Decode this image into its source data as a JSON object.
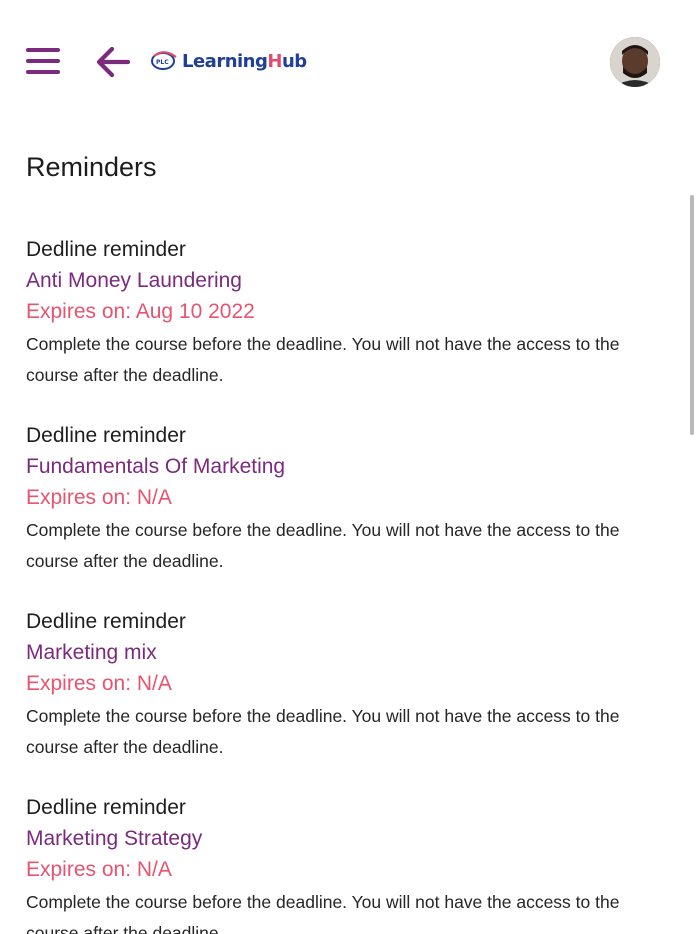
{
  "header": {
    "menu_icon": "hamburger-menu-icon",
    "back_icon": "arrow-left-icon",
    "logo": {
      "mark_text": "PLC",
      "name_prefix": "Learning",
      "name_h": "H",
      "name_suffix": "ub"
    },
    "avatar_icon": "user-avatar"
  },
  "main": {
    "title": "Reminders",
    "reminders": [
      {
        "type": "Dedline reminder",
        "course": "Anti Money Laundering",
        "expiry": "Expires on: Aug 10 2022",
        "description": "Complete the course before the deadline. You will not have the access to the course after the deadline."
      },
      {
        "type": "Dedline reminder",
        "course": "Fundamentals Of Marketing",
        "expiry": "Expires on: N/A",
        "description": "Complete the course before the deadline. You will not have the access to the course after the deadline."
      },
      {
        "type": "Dedline reminder",
        "course": "Marketing mix",
        "expiry": "Expires on: N/A",
        "description": "Complete the course before the deadline. You will not have the access to the course after the deadline."
      },
      {
        "type": "Dedline reminder",
        "course": "Marketing Strategy",
        "expiry": "Expires on: N/A",
        "description": "Complete the course before the deadline. You will not have the access to the course after the deadline."
      }
    ]
  },
  "colors": {
    "primary_purple": "#7b2a7d",
    "expiry_pink": "#e8546f",
    "logo_blue": "#1f3f98"
  }
}
